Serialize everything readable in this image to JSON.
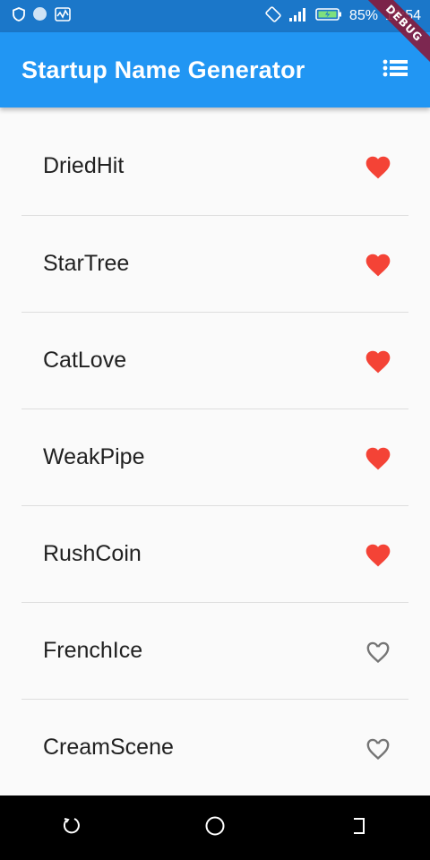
{
  "status_bar": {
    "battery_percent": "85%",
    "time": "18:54"
  },
  "app_bar": {
    "title": "Startup Name Generator",
    "debug_label": "DEBUG"
  },
  "colors": {
    "primary": "#2196f3",
    "status_bar": "#1b77c9",
    "favorite_heart": "#f44336",
    "empty_heart": "#757575"
  },
  "list": {
    "items": [
      {
        "name": "DriedHit",
        "saved": true
      },
      {
        "name": "StarTree",
        "saved": true
      },
      {
        "name": "CatLove",
        "saved": true
      },
      {
        "name": "WeakPipe",
        "saved": true
      },
      {
        "name": "RushCoin",
        "saved": true
      },
      {
        "name": "FrenchIce",
        "saved": false
      },
      {
        "name": "CreamScene",
        "saved": false
      }
    ]
  },
  "icons": {
    "app_bar_action": "list-icon",
    "saved": "heart-filled-icon",
    "unsaved": "heart-outline-icon",
    "nav": [
      "back-icon",
      "home-icon",
      "recents-icon"
    ]
  }
}
